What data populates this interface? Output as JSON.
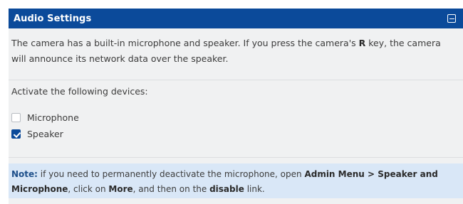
{
  "panel": {
    "title": "Audio Settings",
    "collapse_icon": "collapse-minus-icon"
  },
  "intro": {
    "part1": "The camera has a built-in microphone and speaker. If you press the camera's ",
    "key": "R",
    "part2": " key, the camera will announce its network data over the speaker."
  },
  "devices": {
    "heading": "Activate the following devices:",
    "items": [
      {
        "label": "Microphone",
        "checked": false
      },
      {
        "label": "Speaker",
        "checked": true
      }
    ]
  },
  "note": {
    "label": "Note:",
    "t1": " if you need to permanently deactivate the microphone, open ",
    "menu": "Admin Menu > Speaker and Microphone",
    "t2": ", click on ",
    "more": "More",
    "t3": ", and then on the ",
    "disable": "disable",
    "t4": " link."
  },
  "colors": {
    "header_bg": "#0b4a9a",
    "panel_bg": "#f0f1f2",
    "note_bg": "#d9e7f7",
    "checkbox_checked": "#0b4a9a"
  }
}
